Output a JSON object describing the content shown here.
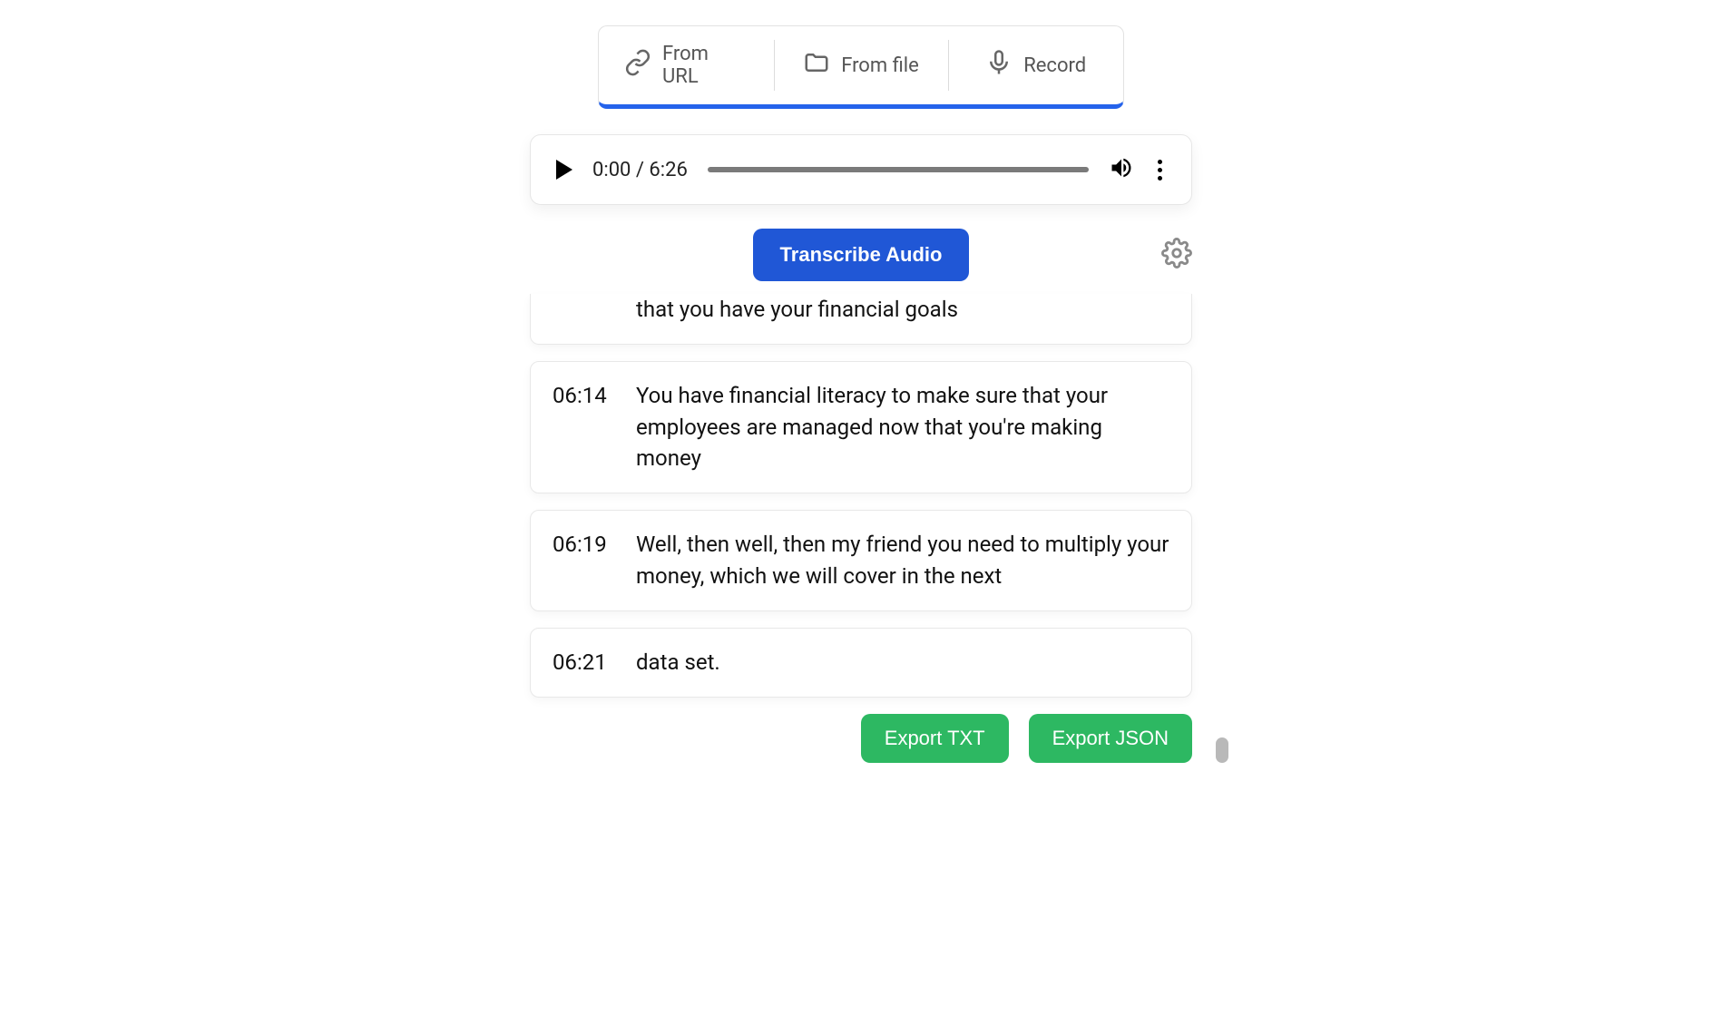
{
  "tabs": {
    "from_url": "From URL",
    "from_file": "From file",
    "record": "Record"
  },
  "player": {
    "time_display": "0:00 / 6:26"
  },
  "actions": {
    "transcribe_label": "Transcribe Audio"
  },
  "transcript": [
    {
      "timestamp": "",
      "text": "that you have your financial goals",
      "partial": true
    },
    {
      "timestamp": "06:14",
      "text": "You have financial literacy to make sure that your employees are managed now that you're making money"
    },
    {
      "timestamp": "06:19",
      "text": "Well, then well, then my friend you need to multiply your money, which we will cover in the next"
    },
    {
      "timestamp": "06:21",
      "text": "data set."
    }
  ],
  "export": {
    "txt_label": "Export TXT",
    "json_label": "Export JSON"
  }
}
